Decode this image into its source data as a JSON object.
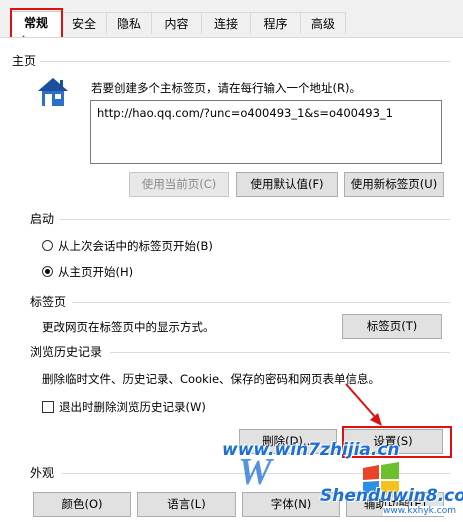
{
  "tabs": [
    "常规",
    "安全",
    "隐私",
    "内容",
    "连接",
    "程序",
    "高级"
  ],
  "homepage": {
    "title": "主页",
    "description": "若要创建多个主标签页，请在每行输入一个地址(R)。",
    "url_value": "http://hao.qq.com/?unc=o400493_1&s=o400493_1",
    "buttons": {
      "use_current": "使用当前页(C)",
      "use_default": "使用默认值(F)",
      "use_new_tab": "使用新标签页(U)"
    }
  },
  "startup": {
    "title": "启动",
    "option_last_session": "从上次会话中的标签页开始(B)",
    "option_homepage": "从主页开始(H)"
  },
  "tabs_section": {
    "title": "标签页",
    "description": "更改网页在标签页中的显示方式。",
    "button": "标签页(T)"
  },
  "history": {
    "title": "浏览历史记录",
    "description": "删除临时文件、历史记录、Cookie、保存的密码和网页表单信息。",
    "checkbox_label": "退出时删除浏览历史记录(W)",
    "delete_button": "删除(D)...",
    "settings_button": "设置(S)"
  },
  "appearance": {
    "title": "外观",
    "colors_button": "颜色(O)",
    "languages_button": "语言(L)",
    "fonts_button": "字体(N)",
    "accessibility_button": "辅助功能(E)"
  },
  "watermark": {
    "top_text": "www.win7zhijia.cn",
    "bottom_brand": "Shenduwin8.com",
    "bottom_url": "www.kxhyk.com"
  },
  "colors": {
    "highlight_red": "#e01010",
    "watermark_blue": "#1d6fd6"
  }
}
